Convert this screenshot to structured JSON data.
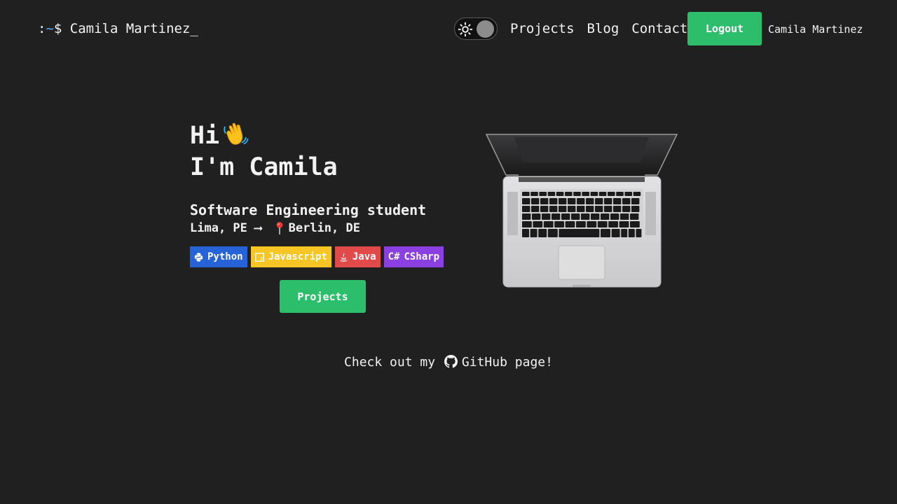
{
  "nav": {
    "brand_prefix_colon": ":",
    "brand_prefix_tilde": "~",
    "brand_prefix_dollar": "$ ",
    "brand_name": "Camila Martinez",
    "brand_cursor": "_",
    "theme_toggle_icon": "sun-icon",
    "links": [
      {
        "label": "Projects"
      },
      {
        "label": "Blog"
      },
      {
        "label": "Contact"
      }
    ],
    "logout_label": "Logout",
    "username": "Camila Martinez",
    "accent_color": "#2dbe6c"
  },
  "hero": {
    "greeting_line1": "Hi",
    "greeting_emoji_icon": "waving-hand-icon",
    "greeting_line2": "I'm Camila",
    "subtitle": "Software Engineering student",
    "location_from": "Lima, PE ⟶ ",
    "location_pin_icon": "pin-icon",
    "location_to": "Berlin, DE",
    "tags": [
      {
        "label": "Python",
        "icon": "python-icon",
        "color": "#2563d6"
      },
      {
        "label": "Javascript",
        "icon": "javascript-icon",
        "color": "#f7c624"
      },
      {
        "label": "Java",
        "icon": "java-icon",
        "color": "#e24a4a"
      },
      {
        "label": "CSharp",
        "icon": "csharp-icon",
        "icon_text": "C#",
        "color": "#8b3fe0"
      }
    ],
    "projects_button_label": "Projects"
  },
  "footer": {
    "github_prefix": "Check out my ",
    "github_icon": "github-icon",
    "github_link_label": "GitHub page!"
  },
  "background_color": "#202020"
}
